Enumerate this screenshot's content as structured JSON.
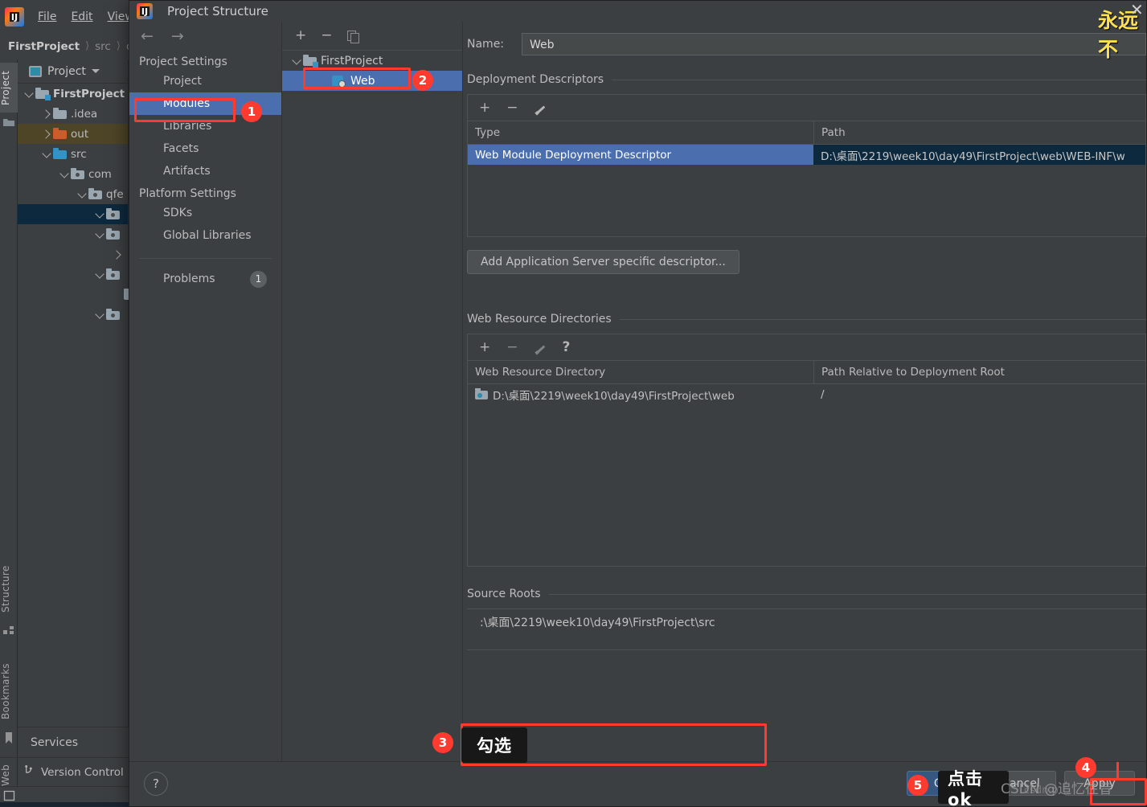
{
  "ide": {
    "logo_text": "IJ",
    "menu": [
      "File",
      "Edit",
      "View"
    ],
    "breadcrumb": [
      {
        "label": "FirstProject",
        "strong": true
      },
      {
        "label": "src",
        "strong": false
      },
      {
        "label": "c",
        "strong": false
      }
    ],
    "left_tabs": [
      {
        "label": "Project",
        "icon": "project-icon",
        "active": true
      },
      {
        "label": "Structure",
        "icon": "structure-icon",
        "active": false
      },
      {
        "label": "Bookmarks",
        "icon": "bookmark-icon",
        "active": false
      },
      {
        "label": "Web",
        "icon": "web-icon",
        "active": false
      }
    ],
    "project_panel": {
      "title": "Project",
      "tree": [
        {
          "label": "FirstProject",
          "arrow": "down",
          "icon": "module-folder-icon",
          "indent": 0,
          "bold": true,
          "state": "none"
        },
        {
          "label": ".idea",
          "arrow": "right",
          "icon": "folder-icon",
          "indent": 1,
          "bold": false,
          "state": "none"
        },
        {
          "label": "out",
          "arrow": "right",
          "icon": "out-folder-icon",
          "indent": 1,
          "bold": false,
          "state": "hl-out"
        },
        {
          "label": "src",
          "arrow": "down",
          "icon": "source-folder-icon",
          "indent": 1,
          "bold": false,
          "state": "none"
        },
        {
          "label": "com",
          "arrow": "down",
          "icon": "package-icon",
          "indent": 2,
          "bold": false,
          "state": "none"
        },
        {
          "label": "qfe",
          "arrow": "down",
          "icon": "package-icon",
          "indent": 3,
          "bold": false,
          "state": "none"
        },
        {
          "label": "",
          "arrow": "down",
          "icon": "package-icon",
          "indent": 4,
          "bold": false,
          "state": "hl-sel"
        },
        {
          "label": "",
          "arrow": "down",
          "icon": "package-icon",
          "indent": 4,
          "bold": false,
          "state": "none"
        },
        {
          "label": "",
          "arrow": "right",
          "icon": "none",
          "indent": 5,
          "bold": false,
          "state": "none"
        },
        {
          "label": "",
          "arrow": "down",
          "icon": "package-icon",
          "indent": 4,
          "bold": false,
          "state": "none"
        },
        {
          "label": "",
          "arrow": "none",
          "icon": "package-icon",
          "indent": 5,
          "bold": false,
          "state": "none"
        },
        {
          "label": "",
          "arrow": "down",
          "icon": "package-icon",
          "indent": 4,
          "bold": false,
          "state": "none"
        }
      ]
    },
    "services_label": "Services",
    "version_control_label": "Version Control"
  },
  "dialog": {
    "title": "Project Structure",
    "nav": {
      "back_icon": "arrow-left-icon",
      "forward_icon": "arrow-right-icon",
      "sections": [
        {
          "header": "Project Settings",
          "items": [
            {
              "label": "Project",
              "selected": false
            },
            {
              "label": "Modules",
              "selected": true
            },
            {
              "label": "Libraries",
              "selected": false
            },
            {
              "label": "Facets",
              "selected": false
            },
            {
              "label": "Artifacts",
              "selected": false
            }
          ]
        },
        {
          "header": "Platform Settings",
          "items": [
            {
              "label": "SDKs",
              "selected": false
            },
            {
              "label": "Global Libraries",
              "selected": false
            }
          ]
        }
      ],
      "problems": {
        "label": "Problems",
        "count": "1"
      }
    },
    "modules": {
      "toolbar": [
        "add-icon",
        "remove-icon",
        "copy-icon"
      ],
      "tree": [
        {
          "label": "FirstProject",
          "arrow": "down",
          "icon": "module-folder-icon",
          "indent": 0,
          "selected": false
        },
        {
          "label": "Web",
          "arrow": "none",
          "icon": "web-module-icon",
          "indent": 1,
          "selected": true
        }
      ]
    },
    "details": {
      "name_label": "Name:",
      "name_value": "Web",
      "deployment": {
        "title": "Deployment Descriptors",
        "toolbar": [
          "add-icon",
          "remove-icon",
          "edit-icon"
        ],
        "columns": [
          "Type",
          "Path"
        ],
        "rows": [
          {
            "type": "Web Module Deployment Descriptor",
            "path": "D:\\桌面\\2219\\week10\\day49\\FirstProject\\web\\WEB-INF\\w",
            "selected": true
          }
        ],
        "add_descriptor_button": "Add Application Server specific descriptor..."
      },
      "web_resources": {
        "title": "Web Resource Directories",
        "toolbar": [
          "add-icon",
          "remove-icon",
          "edit-icon",
          "help-icon"
        ],
        "columns": [
          "Web Resource Directory",
          "Path Relative to Deployment Root"
        ],
        "rows": [
          {
            "directory": "D:\\桌面\\2219\\week10\\day49\\FirstProject\\web",
            "relative": "/"
          }
        ]
      },
      "source_roots": {
        "title": "Source Roots",
        "rows": [
          {
            "path": ":\\桌面\\2219\\week10\\day49\\FirstProject\\src"
          }
        ]
      }
    },
    "footer": {
      "help_label": "?",
      "buttons": [
        {
          "label": "OK",
          "primary": true
        },
        {
          "label": "Cancel",
          "primary": false
        },
        {
          "label": "Apply",
          "primary": false
        }
      ]
    }
  },
  "annotations": {
    "steps": [
      {
        "n": "1",
        "target": "modules-nav-item"
      },
      {
        "n": "2",
        "target": "web-module-row"
      },
      {
        "n": "3",
        "target": "source-roots-row"
      },
      {
        "n": "4",
        "target": "apply-button"
      },
      {
        "n": "5",
        "target": "ok-button"
      }
    ],
    "tooltips": [
      {
        "text": "勾选",
        "target": "source-roots-checkbox"
      },
      {
        "text": "点击ok",
        "target": "ok-button"
      }
    ],
    "top_right_note": "永远不",
    "close_icon": "close-icon",
    "watermark": "CSDN @追忆往昔",
    "watermark_behind": "csdn.p"
  }
}
